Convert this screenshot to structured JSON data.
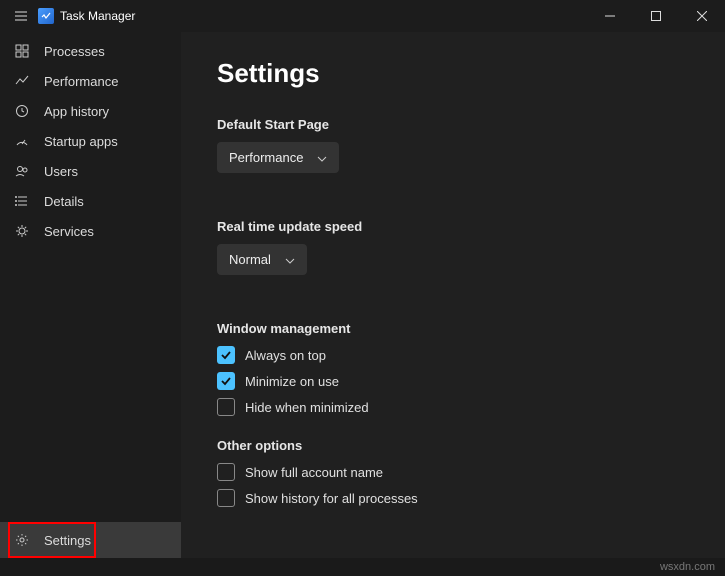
{
  "titlebar": {
    "title": "Task Manager"
  },
  "sidebar": {
    "items": [
      {
        "label": "Processes"
      },
      {
        "label": "Performance"
      },
      {
        "label": "App history"
      },
      {
        "label": "Startup apps"
      },
      {
        "label": "Users"
      },
      {
        "label": "Details"
      },
      {
        "label": "Services"
      }
    ],
    "settings_label": "Settings"
  },
  "page": {
    "title": "Settings",
    "default_start": {
      "label": "Default Start Page",
      "value": "Performance"
    },
    "update_speed": {
      "label": "Real time update speed",
      "value": "Normal"
    },
    "window_mgmt": {
      "label": "Window management",
      "opts": [
        {
          "label": "Always on top",
          "checked": true
        },
        {
          "label": "Minimize on use",
          "checked": true
        },
        {
          "label": "Hide when minimized",
          "checked": false
        }
      ]
    },
    "other": {
      "label": "Other options",
      "opts": [
        {
          "label": "Show full account name",
          "checked": false
        },
        {
          "label": "Show history for all processes",
          "checked": false
        }
      ]
    }
  },
  "watermark": "wsxdn.com"
}
